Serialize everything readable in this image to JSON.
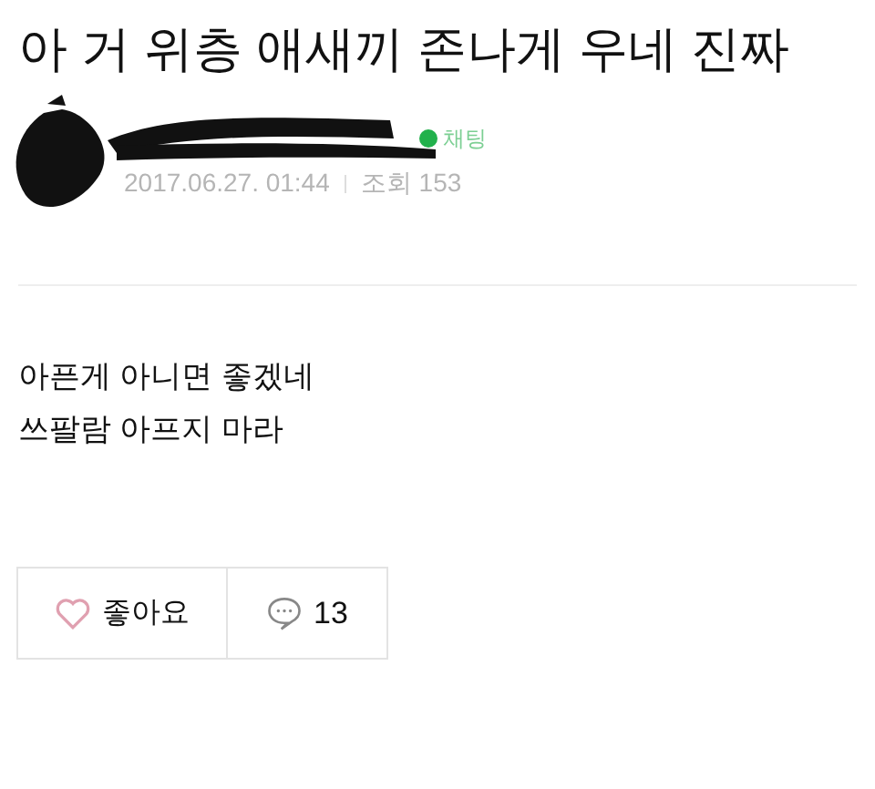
{
  "post": {
    "title": "아 거 위층 애새끼 존나게 우네 진짜",
    "chat_label": "채팅",
    "date": "2017.06.27. 01:44",
    "views": "조회 153",
    "body": [
      "아픈게 아니면 좋겠네",
      "쓰팔람 아프지 마라"
    ]
  },
  "actions": {
    "like_label": "좋아요",
    "liked": false,
    "comment_count": "13"
  }
}
